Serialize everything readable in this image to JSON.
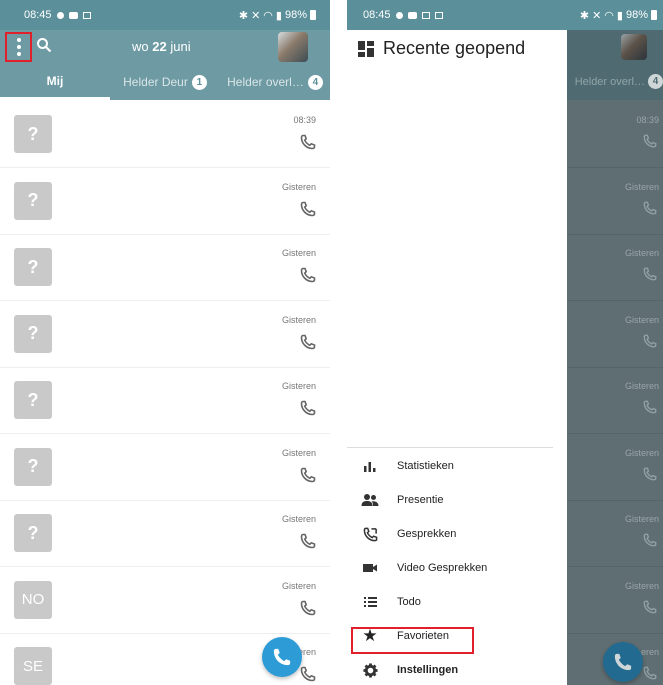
{
  "left": {
    "status": {
      "time": "08:45",
      "battery": "98%"
    },
    "header": {
      "day": "wo",
      "date_num": "22",
      "month": "juni"
    },
    "tabs": [
      {
        "label": "Mij",
        "badge": ""
      },
      {
        "label": "Helder Deur",
        "badge": "1"
      },
      {
        "label": "Helder overl…",
        "badge": "4"
      }
    ],
    "rows": [
      {
        "avatar": "?",
        "time": "08:39"
      },
      {
        "avatar": "?",
        "time": "Gisteren"
      },
      {
        "avatar": "?",
        "time": "Gisteren"
      },
      {
        "avatar": "?",
        "time": "Gisteren"
      },
      {
        "avatar": "?",
        "time": "Gisteren"
      },
      {
        "avatar": "?",
        "time": "Gisteren"
      },
      {
        "avatar": "?",
        "time": "Gisteren"
      },
      {
        "avatar": "NO",
        "time": "Gisteren"
      },
      {
        "avatar": "SE",
        "time": "eren"
      }
    ]
  },
  "right": {
    "status": {
      "time": "08:45",
      "battery": "98%"
    },
    "peek_tab": {
      "label": "Helder overl…",
      "badge": "4"
    },
    "drawer": {
      "title": "Recente geopend",
      "items": [
        {
          "label": "Statistieken",
          "icon": "bar-chart-icon"
        },
        {
          "label": "Presentie",
          "icon": "people-icon"
        },
        {
          "label": "Gesprekken",
          "icon": "call-log-icon"
        },
        {
          "label": "Video Gesprekken",
          "icon": "videocam-icon"
        },
        {
          "label": "Todo",
          "icon": "list-icon"
        },
        {
          "label": "Favorieten",
          "icon": "star-icon"
        },
        {
          "label": "Instellingen",
          "icon": "gear-icon"
        }
      ]
    },
    "scrim_rows": [
      {
        "time": "08:39"
      },
      {
        "time": "Gisteren"
      },
      {
        "time": "Gisteren"
      },
      {
        "time": "Gisteren"
      },
      {
        "time": "Gisteren"
      },
      {
        "time": "Gisteren"
      },
      {
        "time": "Gisteren"
      },
      {
        "time": "Gisteren"
      },
      {
        "time": "eren"
      }
    ]
  },
  "colors": {
    "header": "#6d9aa3",
    "statusbar": "#5b8f99",
    "fab": "#2c9bd6",
    "highlight": "#e0202a",
    "avatar": "#c9c9c9"
  }
}
